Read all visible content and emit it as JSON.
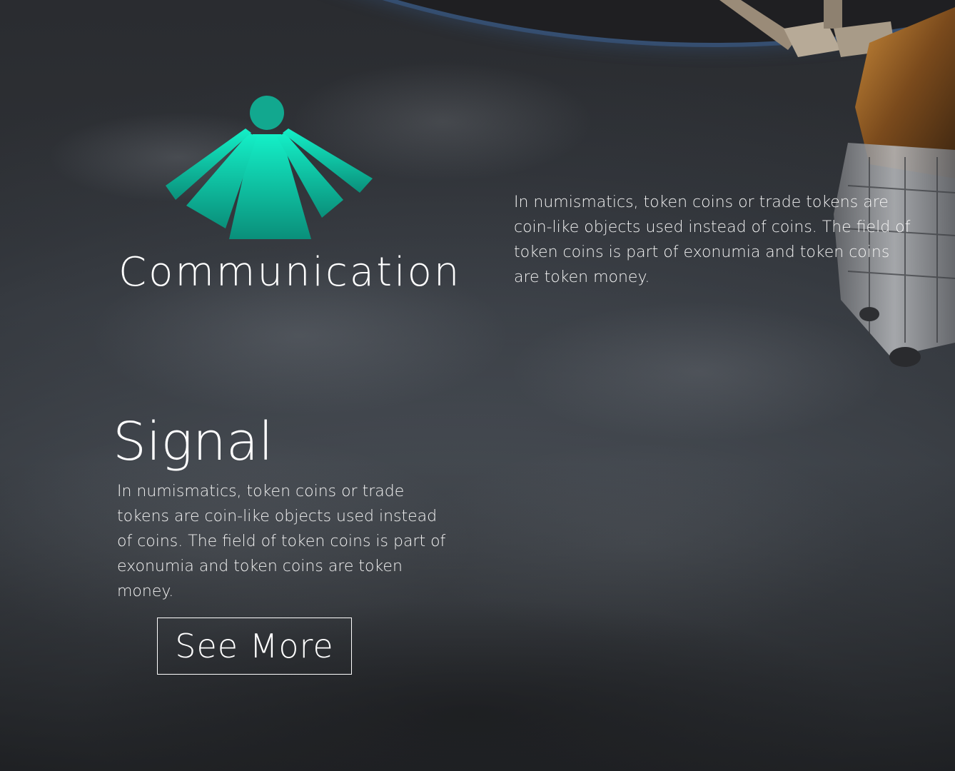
{
  "brand": {
    "logo_icon": "teal-fan-logo-icon",
    "name": "Communication",
    "accent_top": "#14f0c8",
    "accent_bottom": "#0a8f7a"
  },
  "intro": {
    "text": "In numismatics, token coins or trade tokens are coin-like objects used instead of coins. The field of token coins is part of exonumia and token coins are token money."
  },
  "signal": {
    "title": "Signal",
    "text": "In numismatics, token coins or trade tokens are coin-like objects used instead of coins. The field of token coins is part of exonumia and token coins are token money.",
    "button_label": "See More"
  },
  "background": {
    "icon": "earth-orbit-background",
    "decoration": "space-station-icon"
  }
}
